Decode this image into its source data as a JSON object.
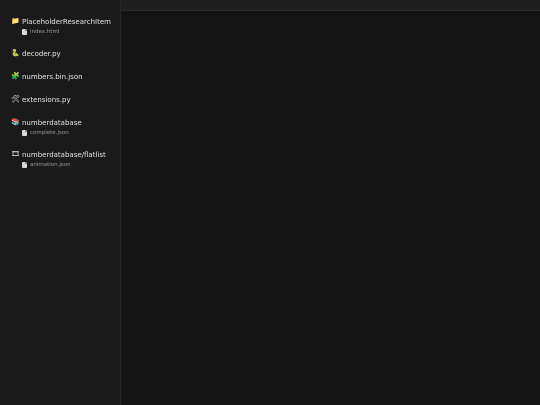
{
  "sidebar": {
    "items": [
      {
        "icon": "folder-icon",
        "glyph": "📁",
        "label": "PlaceholderResearchItem",
        "children": [
          {
            "label": "index.html"
          }
        ]
      },
      {
        "icon": "python-icon",
        "glyph": "🐍",
        "label": "decoder.py",
        "children": []
      },
      {
        "icon": "puzzle-icon",
        "glyph": "🧩",
        "label": "numbers.bin.json",
        "children": []
      },
      {
        "icon": "tools-icon",
        "glyph": "🛠",
        "label": "extensions.py",
        "children": []
      },
      {
        "icon": "books-icon",
        "glyph": "📚",
        "label": "numberdatabase",
        "children": [
          {
            "label": "complete.json"
          }
        ]
      },
      {
        "icon": "film-icon",
        "glyph": "🎞",
        "label": "numberdatabase/flatlist",
        "children": [
          {
            "label": "animation.json"
          }
        ]
      }
    ]
  }
}
